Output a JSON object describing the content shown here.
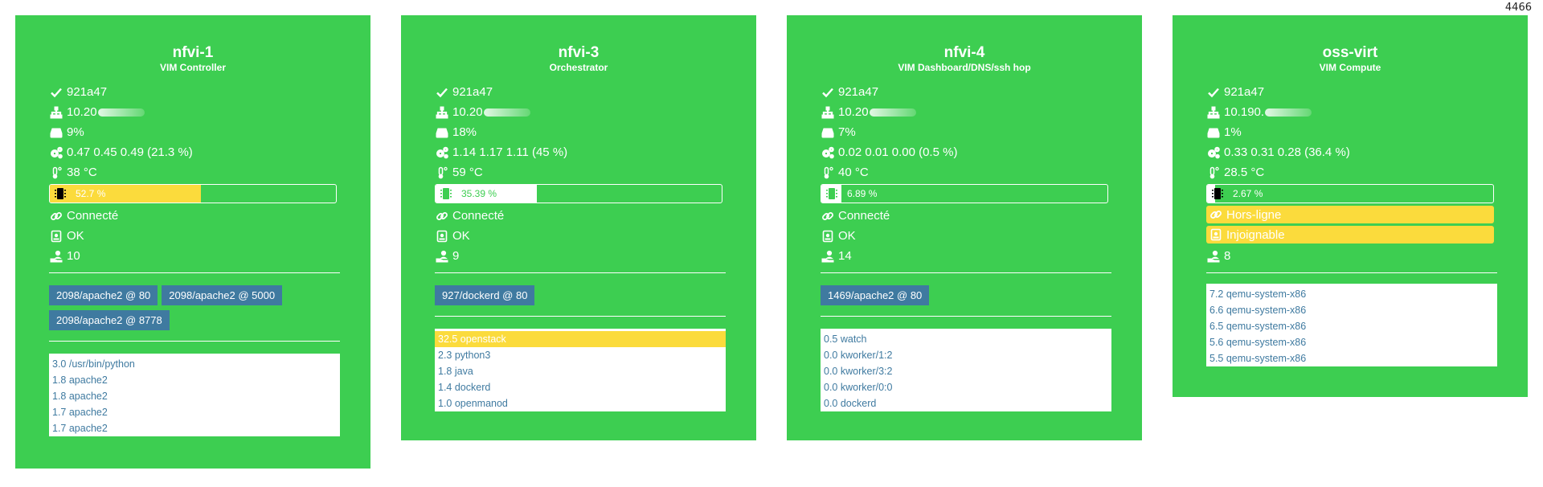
{
  "counter": "4466",
  "colors": {
    "card": "#3dce51",
    "warn": "#fbdb3c",
    "port": "#3f7aa0",
    "white": "#ffffff"
  },
  "cards": [
    {
      "name": "nfvi-1",
      "role": "VIM Controller",
      "commit": "921a47",
      "ip": "10.20",
      "disk": "9%",
      "load": "0.47 0.45 0.49 (21.3 %)",
      "temp": "38 °C",
      "mem": {
        "label": "52.7 %",
        "percent": 52.7,
        "style": "yellow"
      },
      "net": "Connecté",
      "status": "OK",
      "users": "10",
      "ports": [
        "2098/apache2 @ 80",
        "2098/apache2 @ 5000",
        "2098/apache2 @ 8778"
      ],
      "processes": [
        "3.0 /usr/bin/python",
        "1.8 apache2",
        "1.8 apache2",
        "1.7 apache2",
        "1.7 apache2"
      ]
    },
    {
      "name": "nfvi-3",
      "role": "Orchestrator",
      "commit": "921a47",
      "ip": "10.20",
      "disk": "18%",
      "load": "1.14 1.17 1.11 (45 %)",
      "temp": "59 °C",
      "mem": {
        "label": "35.39 %",
        "percent": 35.39,
        "style": "white"
      },
      "net": "Connecté",
      "status": "OK",
      "users": "9",
      "ports": [
        "927/dockerd @ 80"
      ],
      "processes": [
        "32.5 openstack",
        "2.3 python3",
        "1.8 java",
        "1.4 dockerd",
        "1.0 openmanod"
      ]
    },
    {
      "name": "nfvi-4",
      "role": "VIM Dashboard/DNS/ssh hop",
      "commit": "921a47",
      "ip": "10.20",
      "disk": "7%",
      "load": "0.02 0.01 0.00 (0.5 %)",
      "temp": "40 °C",
      "mem": {
        "label": "6.89 %",
        "percent": 6.89,
        "style": "white"
      },
      "net": "Connecté",
      "status": "OK",
      "users": "14",
      "ports": [
        "1469/apache2 @ 80"
      ],
      "processes": [
        "0.5 watch",
        "0.0 kworker/1:2",
        "0.0 kworker/3:2",
        "0.0 kworker/0:0",
        "0.0 dockerd"
      ]
    },
    {
      "name": "oss-virt",
      "role": "VIM Compute",
      "commit": "921a47",
      "ip": "10.190.",
      "disk": "1%",
      "load": "0.33 0.31 0.28 (36.4 %)",
      "temp": "28.5 °C",
      "mem": {
        "label": "2.67 %",
        "percent": 2.67,
        "style": "white"
      },
      "net": "Hors-ligne",
      "status": "Injoignable",
      "users": "8",
      "ports": [],
      "processes": [
        "7.2 qemu-system-x86",
        "6.6 qemu-system-x86",
        "6.5 qemu-system-x86",
        "5.6 qemu-system-x86",
        "5.5 qemu-system-x86"
      ]
    }
  ]
}
